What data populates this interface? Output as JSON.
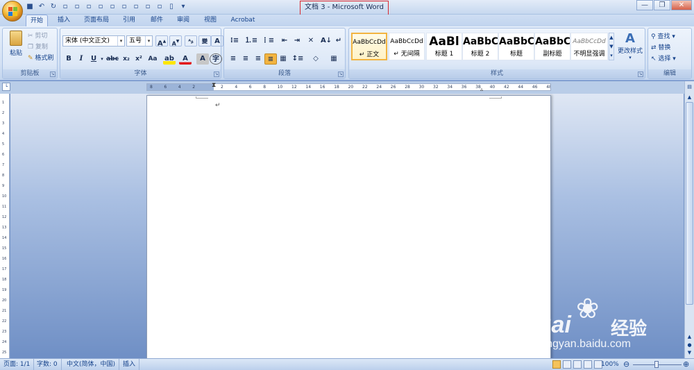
{
  "window": {
    "title": "文档 3 - Microsoft Word",
    "minimize": "—",
    "restore": "❐",
    "close": "✕"
  },
  "tabs": [
    {
      "label": "开始",
      "active": true
    },
    {
      "label": "插入",
      "active": false
    },
    {
      "label": "页面布局",
      "active": false
    },
    {
      "label": "引用",
      "active": false
    },
    {
      "label": "邮件",
      "active": false
    },
    {
      "label": "审阅",
      "active": false
    },
    {
      "label": "视图",
      "active": false
    },
    {
      "label": "Acrobat",
      "active": false
    }
  ],
  "clipboard": {
    "caption": "剪贴板",
    "paste": "粘贴",
    "cut": "剪切",
    "copy": "复制",
    "format_painter": "格式刷"
  },
  "font": {
    "caption": "字体",
    "font_name": "宋体 (中文正文)",
    "font_size": "五号",
    "grow": "A",
    "shrink": "A",
    "bold": "B",
    "italic": "I",
    "underline": "U",
    "strike": "abc",
    "subscript": "x₂",
    "superscript": "x²",
    "change_case": "Aa",
    "font_color": "A"
  },
  "paragraph": {
    "caption": "段落"
  },
  "styles": {
    "caption": "样式",
    "items": [
      {
        "sample": "AaBbCcDd",
        "name": "↵ 正文"
      },
      {
        "sample": "AaBbCcDd",
        "name": "↵ 无间隔"
      },
      {
        "sample": "AaBl",
        "name": "标题 1"
      },
      {
        "sample": "AaBbC",
        "name": "标题 2"
      },
      {
        "sample": "AaBbC",
        "name": "标题"
      },
      {
        "sample": "AaBbC",
        "name": "副标题"
      },
      {
        "sample": "AaBbCcDd",
        "name": "不明显强调"
      }
    ],
    "change_styles": "更改样式"
  },
  "editing": {
    "caption": "编辑",
    "find": "查找",
    "replace": "替换",
    "select": "选择"
  },
  "ruler": {
    "h_ticks": [
      "8",
      "6",
      "4",
      "2",
      "",
      "2",
      "4",
      "6",
      "8",
      "10",
      "12",
      "14",
      "16",
      "18",
      "20",
      "22",
      "24",
      "26",
      "28",
      "30",
      "32",
      "34",
      "36",
      "38",
      "40",
      "42",
      "44",
      "46",
      "48"
    ],
    "v_ticks": [
      "1",
      "2",
      "3",
      "4",
      "5",
      "6",
      "7",
      "8",
      "9",
      "10",
      "11",
      "12",
      "13",
      "14",
      "15",
      "16",
      "17",
      "18",
      "19",
      "20",
      "21",
      "22",
      "23",
      "24",
      "25"
    ]
  },
  "document": {
    "paragraph_mark": "↵"
  },
  "status": {
    "page": "页面: 1/1",
    "words": "字数: 0",
    "language": "中文(简体，中国)",
    "mode": "插入",
    "zoom": "100%"
  },
  "watermark": {
    "brand": "Bai",
    "brand2": "经验",
    "url": "jingyan.baidu.com"
  }
}
